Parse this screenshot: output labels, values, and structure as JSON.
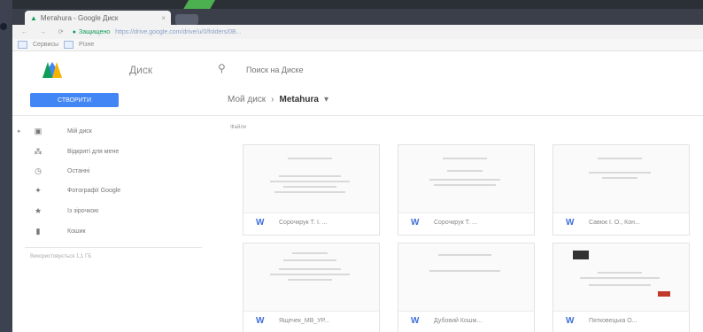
{
  "browser": {
    "tab_title": "Метаhura - Google Диск",
    "tab_close": "×",
    "nav_buttons": "← → ⟳",
    "secure_label": "Защищено",
    "url": "https://drive.google.com/drive/u/0/folders/0B...",
    "bookmarks": [
      "Сервисы",
      "Різне"
    ]
  },
  "header": {
    "app_name": "Диск",
    "search_placeholder": "Поиск на Диске"
  },
  "toolbar": {
    "create_label": "СТВОРИТИ",
    "breadcrumb_root": "Мой диск",
    "breadcrumb_sep": "›",
    "breadcrumb_current": "Metahura",
    "breadcrumb_caret": "▾"
  },
  "sidebar": {
    "items": [
      {
        "icon": "▣",
        "label": "Мій диск"
      },
      {
        "icon": "⁂",
        "label": "Відкриті для мене"
      },
      {
        "icon": "◷",
        "label": "Останні"
      },
      {
        "icon": "✦",
        "label": "Фотографії Google"
      },
      {
        "icon": "★",
        "label": "Із зірочкою"
      },
      {
        "icon": "▮",
        "label": "Кошик"
      }
    ],
    "storage": "Використовується 1,1 ГБ"
  },
  "main": {
    "section_label": "Файли",
    "files": [
      {
        "name": "Сорочкрук Т. І. ...",
        "icon": "W"
      },
      {
        "name": "Сорочкрук Т. ...",
        "icon": "W"
      },
      {
        "name": "Савюк І. О., Кон...",
        "icon": "W"
      },
      {
        "name": "Ящечек_МВ_УР...",
        "icon": "W"
      },
      {
        "name": "Дубовий Кошм...",
        "icon": "W"
      },
      {
        "name": "Пятковецька О...",
        "icon": "W"
      }
    ]
  },
  "colors": {
    "accent": "#4285f4",
    "word_icon": "#3f6fd8"
  }
}
